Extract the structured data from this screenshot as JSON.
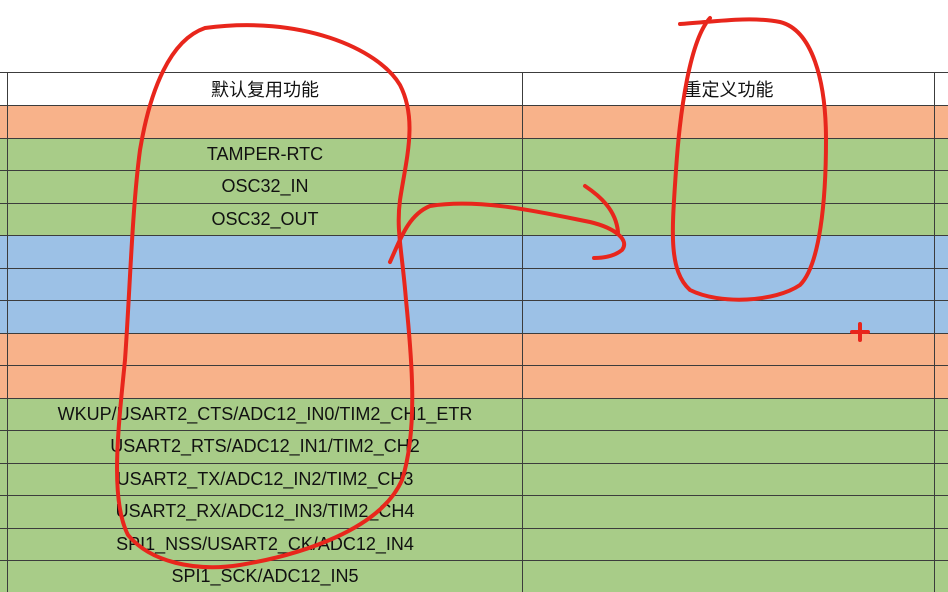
{
  "header": {
    "default_function": "默认复用功能",
    "redefined_function": "重定义功能"
  },
  "rows": [
    {
      "color": "orange",
      "default": "",
      "remap": ""
    },
    {
      "color": "green",
      "default": "TAMPER-RTC",
      "remap": ""
    },
    {
      "color": "green",
      "default": "OSC32_IN",
      "remap": ""
    },
    {
      "color": "green",
      "default": "OSC32_OUT",
      "remap": ""
    },
    {
      "color": "blue",
      "default": "",
      "remap": ""
    },
    {
      "color": "blue",
      "default": "",
      "remap": ""
    },
    {
      "color": "blue",
      "default": "",
      "remap": ""
    },
    {
      "color": "orange",
      "default": "",
      "remap": ""
    },
    {
      "color": "orange",
      "default": "",
      "remap": ""
    },
    {
      "color": "green",
      "default": "WKUP/USART2_CTS/ADC12_IN0/TIM2_CH1_ETR",
      "remap": ""
    },
    {
      "color": "green",
      "default": "USART2_RTS/ADC12_IN1/TIM2_CH2",
      "remap": ""
    },
    {
      "color": "green",
      "default": "USART2_TX/ADC12_IN2/TIM2_CH3",
      "remap": ""
    },
    {
      "color": "green",
      "default": "USART2_RX/ADC12_IN3/TIM2_CH4",
      "remap": ""
    },
    {
      "color": "green",
      "default": "SPI1_NSS/USART2_CK/ADC12_IN4",
      "remap": ""
    },
    {
      "color": "green",
      "default": "SPI1_SCK/ADC12_IN5",
      "remap": ""
    }
  ],
  "colors": {
    "orange": "#f8b28a",
    "green": "#a8cc88",
    "blue": "#9cc1e6",
    "annotation": "#e8261c"
  }
}
